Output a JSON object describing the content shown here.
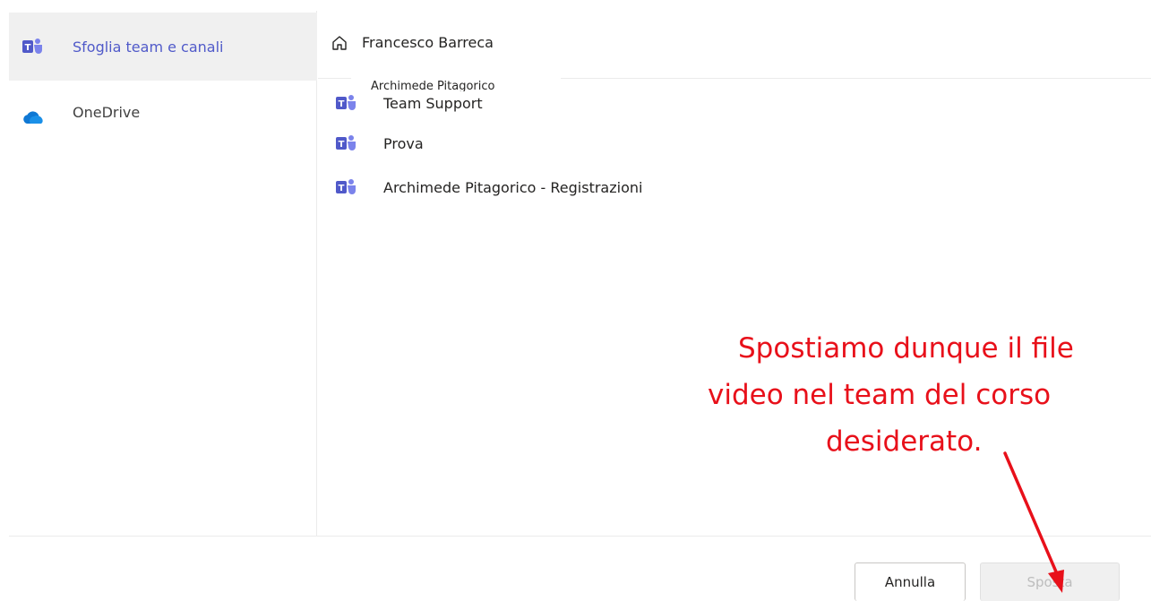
{
  "sidebar": {
    "items": [
      {
        "label": "Sfoglia team e canali",
        "icon": "teams-icon",
        "selected": true
      },
      {
        "label": "OneDrive",
        "icon": "onedrive-icon",
        "selected": false
      }
    ]
  },
  "header": {
    "breadcrumb_icon": "home-icon",
    "breadcrumb": "Francesco Barreca",
    "tooltip": "Archimede Pitagorico"
  },
  "teams": [
    {
      "label": "Team Support",
      "icon": "teams-icon"
    },
    {
      "label": "Prova",
      "icon": "teams-icon"
    },
    {
      "label": "Archimede Pitagorico - Registrazioni",
      "icon": "teams-icon"
    }
  ],
  "annotation": {
    "line1": "Spostiamo dunque il file",
    "line2": "video nel team del corso",
    "line3": "desiderato.",
    "color": "#e8101a"
  },
  "footer": {
    "cancel_label": "Annulla",
    "move_label": "Sposta"
  },
  "colors": {
    "accent": "#505ac9",
    "teams_purple": "#5059c9",
    "onedrive_blue": "#0f78d4"
  }
}
